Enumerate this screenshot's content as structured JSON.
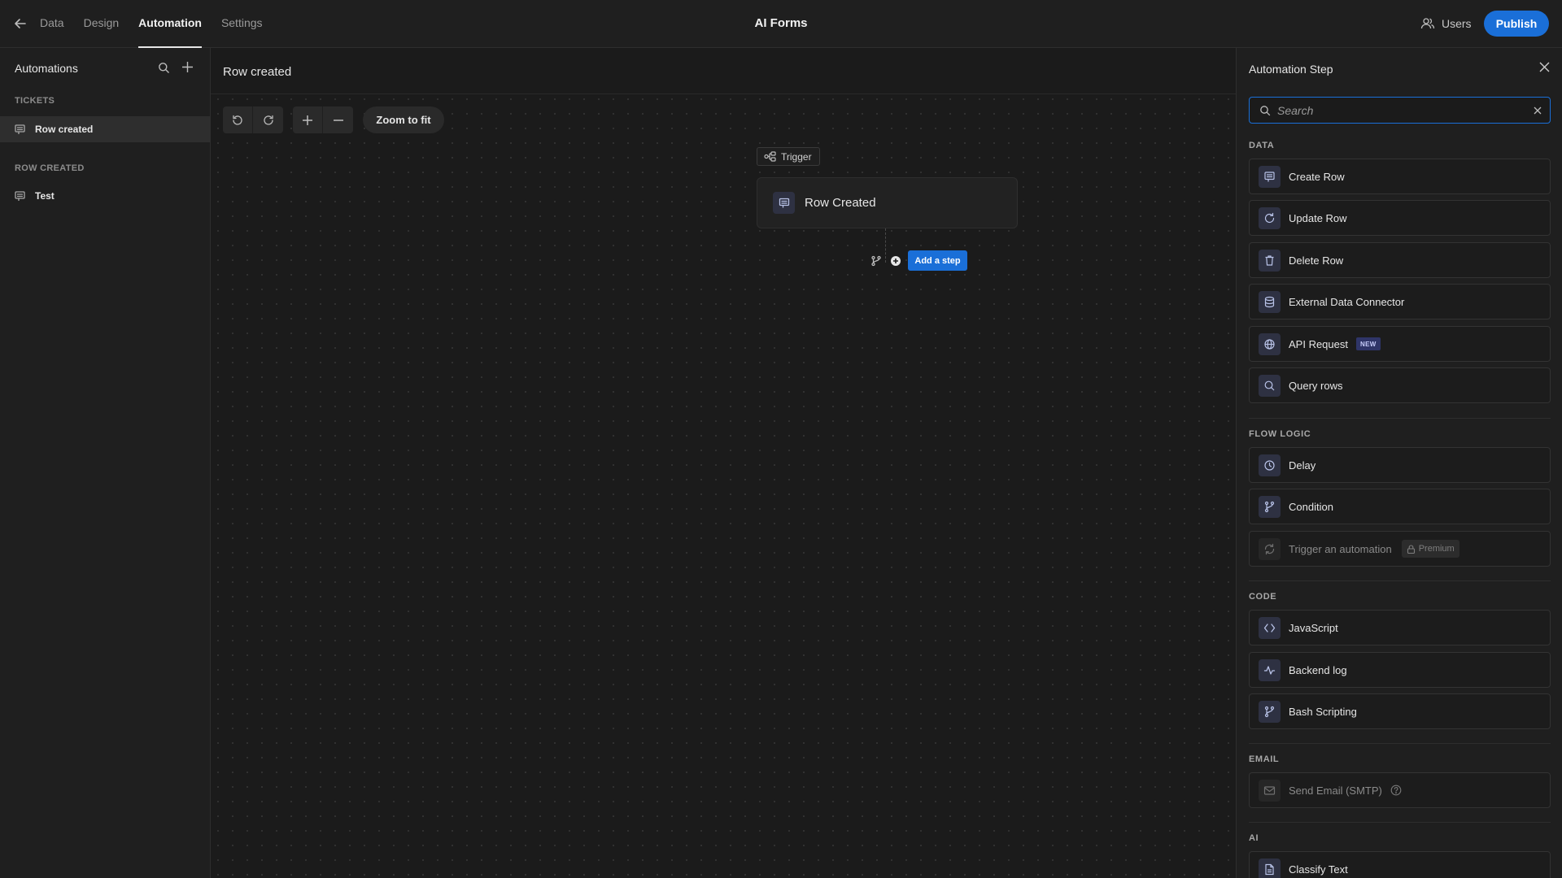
{
  "nav": {
    "tabs": [
      {
        "label": "Data",
        "active": false
      },
      {
        "label": "Design",
        "active": false
      },
      {
        "label": "Automation",
        "active": true
      },
      {
        "label": "Settings",
        "active": false
      }
    ],
    "app_title": "AI Forms",
    "users_label": "Users",
    "publish_label": "Publish"
  },
  "sidebar": {
    "title": "Automations",
    "groups": [
      {
        "heading": "TICKETS",
        "items": [
          {
            "label": "Row created",
            "active": true
          }
        ]
      },
      {
        "heading": "ROW CREATED",
        "items": [
          {
            "label": "Test",
            "active": false
          }
        ]
      }
    ]
  },
  "canvas": {
    "title": "Row created",
    "zoom_fit_label": "Zoom to fit",
    "trigger_tag": "Trigger",
    "trigger_card": "Row Created",
    "add_step_label": "Add a step"
  },
  "panel": {
    "title": "Automation Step",
    "search": {
      "placeholder": "Search",
      "value": ""
    },
    "categories": [
      {
        "heading": "DATA",
        "steps": [
          {
            "label": "Create Row",
            "icon": "table-row-icon"
          },
          {
            "label": "Update Row",
            "icon": "refresh-icon"
          },
          {
            "label": "Delete Row",
            "icon": "trash-icon"
          },
          {
            "label": "External Data Connector",
            "icon": "database-icon"
          },
          {
            "label": "API Request",
            "icon": "globe-icon",
            "tag": "NEW"
          },
          {
            "label": "Query rows",
            "icon": "search-icon"
          }
        ]
      },
      {
        "heading": "FLOW LOGIC",
        "steps": [
          {
            "label": "Delay",
            "icon": "clock-icon"
          },
          {
            "label": "Condition",
            "icon": "branch-icon"
          },
          {
            "label": "Trigger an automation",
            "icon": "refresh-icon",
            "tag": "Premium",
            "disabled": true
          }
        ]
      },
      {
        "heading": "CODE",
        "steps": [
          {
            "label": "JavaScript",
            "icon": "code-icon"
          },
          {
            "label": "Backend log",
            "icon": "pulse-icon"
          },
          {
            "label": "Bash Scripting",
            "icon": "branch-icon"
          }
        ]
      },
      {
        "heading": "EMAIL",
        "steps": [
          {
            "label": "Send Email (SMTP)",
            "icon": "mail-icon",
            "disabled": true,
            "help": true
          }
        ]
      },
      {
        "heading": "AI",
        "steps": [
          {
            "label": "Classify Text",
            "icon": "document-icon"
          }
        ]
      }
    ]
  },
  "colors": {
    "accent": "#1a6fd8",
    "background": "#1b1b1b",
    "panel": "#1f1f1f"
  }
}
